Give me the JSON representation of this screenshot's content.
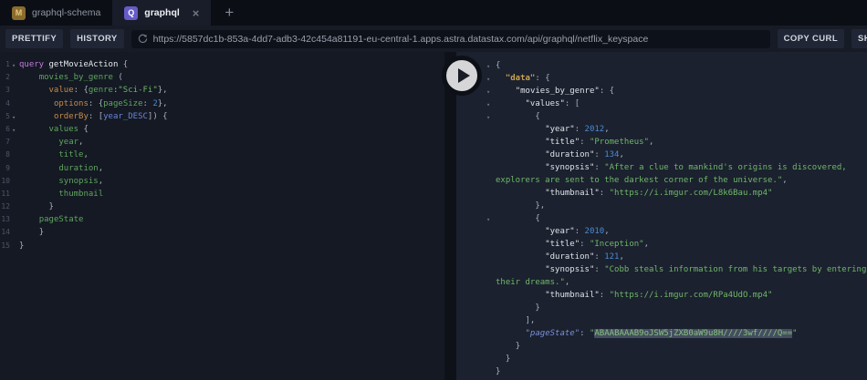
{
  "tabs": {
    "items": [
      {
        "label": "graphql-schema",
        "icon_letter": "M",
        "icon_bg": "#8a6c2e",
        "icon_color": "#e3c77c",
        "active": false
      },
      {
        "label": "graphql",
        "icon_letter": "Q",
        "icon_bg": "#655cc8",
        "icon_color": "#ffffff",
        "active": true
      }
    ],
    "close_glyph": "×",
    "add_glyph": "+"
  },
  "toolbar": {
    "prettify_label": "PRETTIFY",
    "history_label": "HISTORY",
    "endpoint_url": "https://5857dc1b-853a-4dd7-adb3-42c454a81191-eu-central-1.apps.astra.datastax.com/api/graphql/netflix_keyspace",
    "copy_curl_label": "COPY CURL",
    "share_label": "SHARE PLAYGROUND"
  },
  "icons": {
    "fold_glyph": "▾"
  },
  "colors": {
    "active_tab_bg": "#181d29",
    "editor_bg": "#141923",
    "results_bg": "#1b212e",
    "tokens": {
      "kw": "#c678dd",
      "plain": "#d5d9e0",
      "name": "#e6e9ee",
      "field": "#5fa55f",
      "arg": "#c78a4e",
      "str": "#6fb76a",
      "num": "#4a8bd6",
      "enum": "#6b85d8",
      "punc": "#a9b0bd",
      "key": "#dfe3ea",
      "keyroot": "#c9a350",
      "keypage": "#7b90dc",
      "sel": "#87c27f",
      "selbg": "#454e61"
    }
  },
  "editor": {
    "lines": [
      {
        "num": 1,
        "ind": 0,
        "fold": true,
        "tokens": [
          [
            "kw",
            "query"
          ],
          [
            "plain",
            " "
          ],
          [
            "name",
            "getMovieAction"
          ],
          [
            "punc",
            " {"
          ]
        ]
      },
      {
        "num": 2,
        "ind": 4,
        "fold": false,
        "tokens": [
          [
            "field",
            "movies_by_genre"
          ],
          [
            "punc",
            " ("
          ]
        ]
      },
      {
        "num": 3,
        "ind": 6,
        "fold": false,
        "tokens": [
          [
            "arg",
            "value"
          ],
          [
            "punc",
            ": {"
          ],
          [
            "field",
            "genre"
          ],
          [
            "punc",
            ":"
          ],
          [
            "str",
            "\"Sci-Fi\""
          ],
          [
            "punc",
            "},"
          ]
        ]
      },
      {
        "num": 4,
        "ind": 7,
        "fold": false,
        "tokens": [
          [
            "arg",
            "options"
          ],
          [
            "punc",
            ": {"
          ],
          [
            "field",
            "pageSize"
          ],
          [
            "punc",
            ": "
          ],
          [
            "num",
            "2"
          ],
          [
            "punc",
            "},"
          ]
        ]
      },
      {
        "num": 5,
        "ind": 7,
        "fold": true,
        "tokens": [
          [
            "arg",
            "orderBy"
          ],
          [
            "punc",
            ": ["
          ],
          [
            "enum",
            "year_DESC"
          ],
          [
            "punc",
            "]) {"
          ]
        ]
      },
      {
        "num": 6,
        "ind": 6,
        "fold": true,
        "tokens": [
          [
            "field",
            "values"
          ],
          [
            "punc",
            " {"
          ]
        ]
      },
      {
        "num": 7,
        "ind": 8,
        "fold": false,
        "tokens": [
          [
            "field",
            "year"
          ],
          [
            "punc",
            ","
          ]
        ]
      },
      {
        "num": 8,
        "ind": 8,
        "fold": false,
        "tokens": [
          [
            "field",
            "title"
          ],
          [
            "punc",
            ","
          ]
        ]
      },
      {
        "num": 9,
        "ind": 8,
        "fold": false,
        "tokens": [
          [
            "field",
            "duration"
          ],
          [
            "punc",
            ","
          ]
        ]
      },
      {
        "num": 10,
        "ind": 8,
        "fold": false,
        "tokens": [
          [
            "field",
            "synopsis"
          ],
          [
            "punc",
            ","
          ]
        ]
      },
      {
        "num": 11,
        "ind": 8,
        "fold": false,
        "tokens": [
          [
            "field",
            "thumbnail"
          ]
        ]
      },
      {
        "num": 12,
        "ind": 6,
        "fold": false,
        "tokens": [
          [
            "punc",
            "}"
          ]
        ]
      },
      {
        "num": 13,
        "ind": 4,
        "fold": false,
        "tokens": [
          [
            "field",
            "pageState"
          ]
        ]
      },
      {
        "num": 14,
        "ind": 4,
        "fold": false,
        "tokens": [
          [
            "punc",
            "}"
          ]
        ]
      },
      {
        "num": 15,
        "ind": 0,
        "fold": false,
        "tokens": [
          [
            "punc",
            "}"
          ]
        ]
      }
    ]
  },
  "results": {
    "lines": [
      {
        "ind": 0,
        "fold": true,
        "tokens": [
          [
            "punc",
            "{"
          ]
        ]
      },
      {
        "ind": 2,
        "fold": true,
        "tokens": [
          [
            "keyroot",
            "\"data\""
          ],
          [
            "punc",
            ": {"
          ]
        ]
      },
      {
        "ind": 4,
        "fold": true,
        "tokens": [
          [
            "key",
            "\"movies_by_genre\""
          ],
          [
            "punc",
            ": {"
          ]
        ]
      },
      {
        "ind": 6,
        "fold": true,
        "tokens": [
          [
            "key",
            "\"values\""
          ],
          [
            "punc",
            ": ["
          ]
        ]
      },
      {
        "ind": 8,
        "fold": true,
        "tokens": [
          [
            "punc",
            "{"
          ]
        ]
      },
      {
        "ind": 10,
        "fold": false,
        "tokens": [
          [
            "key",
            "\"year\""
          ],
          [
            "punc",
            ": "
          ],
          [
            "num",
            "2012"
          ],
          [
            "punc",
            ","
          ]
        ]
      },
      {
        "ind": 10,
        "fold": false,
        "tokens": [
          [
            "key",
            "\"title\""
          ],
          [
            "punc",
            ": "
          ],
          [
            "str",
            "\"Prometheus\""
          ],
          [
            "punc",
            ","
          ]
        ]
      },
      {
        "ind": 10,
        "fold": false,
        "tokens": [
          [
            "key",
            "\"duration\""
          ],
          [
            "punc",
            ": "
          ],
          [
            "num",
            "134"
          ],
          [
            "punc",
            ","
          ]
        ]
      },
      {
        "ind": 10,
        "fold": false,
        "tokens": [
          [
            "key",
            "\"synopsis\""
          ],
          [
            "punc",
            ": "
          ],
          [
            "str",
            "\"After a clue to mankind's origins is discovered,"
          ]
        ]
      },
      {
        "ind": 0,
        "fold": false,
        "tokens": [
          [
            "str",
            "explorers are sent to the darkest corner of the universe.\""
          ],
          [
            "punc",
            ","
          ]
        ]
      },
      {
        "ind": 10,
        "fold": false,
        "tokens": [
          [
            "key",
            "\"thumbnail\""
          ],
          [
            "punc",
            ": "
          ],
          [
            "str",
            "\"https://i.imgur.com/L8k6Bau.mp4\""
          ]
        ]
      },
      {
        "ind": 8,
        "fold": false,
        "tokens": [
          [
            "punc",
            "},"
          ]
        ]
      },
      {
        "ind": 8,
        "fold": true,
        "tokens": [
          [
            "punc",
            "{"
          ]
        ]
      },
      {
        "ind": 10,
        "fold": false,
        "tokens": [
          [
            "key",
            "\"year\""
          ],
          [
            "punc",
            ": "
          ],
          [
            "num",
            "2010"
          ],
          [
            "punc",
            ","
          ]
        ]
      },
      {
        "ind": 10,
        "fold": false,
        "tokens": [
          [
            "key",
            "\"title\""
          ],
          [
            "punc",
            ": "
          ],
          [
            "str",
            "\"Inception\""
          ],
          [
            "punc",
            ","
          ]
        ]
      },
      {
        "ind": 10,
        "fold": false,
        "tokens": [
          [
            "key",
            "\"duration\""
          ],
          [
            "punc",
            ": "
          ],
          [
            "num",
            "121"
          ],
          [
            "punc",
            ","
          ]
        ]
      },
      {
        "ind": 10,
        "fold": false,
        "tokens": [
          [
            "key",
            "\"synopsis\""
          ],
          [
            "punc",
            ": "
          ],
          [
            "str",
            "\"Cobb steals information from his targets by entering"
          ]
        ]
      },
      {
        "ind": 0,
        "fold": false,
        "tokens": [
          [
            "str",
            "their dreams.\""
          ],
          [
            "punc",
            ","
          ]
        ]
      },
      {
        "ind": 10,
        "fold": false,
        "tokens": [
          [
            "key",
            "\"thumbnail\""
          ],
          [
            "punc",
            ": "
          ],
          [
            "str",
            "\"https://i.imgur.com/RPa4UdO.mp4\""
          ]
        ]
      },
      {
        "ind": 8,
        "fold": false,
        "tokens": [
          [
            "punc",
            "}"
          ]
        ]
      },
      {
        "ind": 6,
        "fold": false,
        "tokens": [
          [
            "punc",
            "],"
          ]
        ]
      },
      {
        "ind": 6,
        "fold": false,
        "tokens": [
          [
            "keypage",
            "\"pageState\""
          ],
          [
            "punc",
            ": "
          ],
          [
            "str",
            "\""
          ],
          [
            "sel",
            "ABAABAAAB9oJSW5jZXB0aW9u8H////3wf////Q=="
          ],
          [
            "str",
            "\""
          ]
        ]
      },
      {
        "ind": 4,
        "fold": false,
        "tokens": [
          [
            "punc",
            "}"
          ]
        ]
      },
      {
        "ind": 2,
        "fold": false,
        "tokens": [
          [
            "punc",
            "}"
          ]
        ]
      },
      {
        "ind": 0,
        "fold": false,
        "tokens": [
          [
            "punc",
            "}"
          ]
        ]
      }
    ]
  }
}
